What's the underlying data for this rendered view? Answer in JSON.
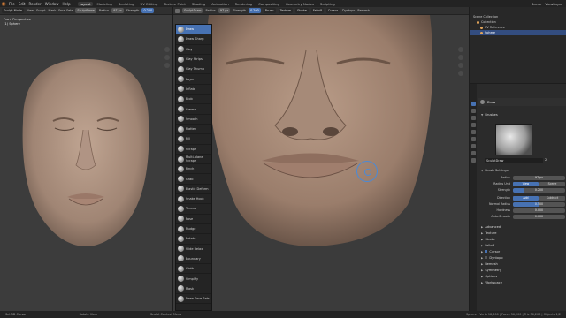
{
  "menu": {
    "items": [
      "File",
      "Edit",
      "Render",
      "Window",
      "Help"
    ]
  },
  "workspaces": [
    "Layout",
    "Modeling",
    "Sculpting",
    "UV Editing",
    "Texture Paint",
    "Shading",
    "Animation",
    "Rendering",
    "Compositing",
    "Geometry Nodes",
    "Scripting"
  ],
  "top_right": {
    "scene": "Scene",
    "view_layer": "ViewLayer"
  },
  "left_header": {
    "mode": "Sculpt Mode",
    "view": "View",
    "sculpt": "Sculpt",
    "mask": "Mask",
    "face_sets": "Face Sets",
    "brush": "SculptDraw",
    "radius_label": "Radius",
    "radius": "97 px",
    "strength_label": "Strength",
    "strength": "0.200"
  },
  "mid_header": {
    "brush": "SculptDraw",
    "radius_label": "Radius",
    "radius": "97 px",
    "strength_label": "Strength",
    "strength": "0.200",
    "menus": [
      "Brush",
      "Texture",
      "Stroke",
      "Falloff",
      "Cursor"
    ],
    "dyntopo": "Dyntopo",
    "remesh": "Remesh"
  },
  "left_viewport": {
    "title": "Front Perspective",
    "object": "(1) Sphere"
  },
  "mid_viewport": {
    "title": "User Perspective",
    "object": "(1) Sphere"
  },
  "brushes": [
    "Draw",
    "Draw Sharp",
    "Clay",
    "Clay Strips",
    "Clay Thumb",
    "Layer",
    "Inflate",
    "Blob",
    "Crease",
    "Smooth",
    "Flatten",
    "Fill",
    "Scrape",
    "Multi-plane Scrape",
    "Pinch",
    "Grab",
    "Elastic Deform",
    "Snake Hook",
    "Thumb",
    "Pose",
    "Nudge",
    "Rotate",
    "Slide Relax",
    "Boundary",
    "Cloth",
    "Simplify",
    "Mask",
    "Draw Face Sets"
  ],
  "outliner": {
    "rows": [
      "Scene Collection",
      "Collection",
      "UV Reference",
      "Sphere"
    ]
  },
  "properties": {
    "tool_title": "Draw",
    "brushes_section": "Brushes",
    "brush_name": "SculptDraw",
    "brush_users": "2",
    "brush_settings": "Brush Settings",
    "radius_label": "Radius",
    "radius": "97 px",
    "radius_unit_label": "Radius Unit",
    "radius_unit": [
      "View",
      "Scene"
    ],
    "strength_label": "Strength",
    "strength": "0.200",
    "strength_fraction": 0.2,
    "direction_label": "Direction",
    "direction": [
      "Add",
      "Subtract"
    ],
    "normal_radius_label": "Normal Radius",
    "normal_radius": "0.500",
    "normal_radius_fraction": 0.5,
    "hardness_label": "Hardness",
    "hardness": "0.000",
    "autosmooth_label": "Auto-Smooth",
    "autosmooth": "0.000",
    "subsections": [
      "Advanced",
      "Texture",
      "Stroke",
      "Falloff",
      "Cursor"
    ],
    "panels": [
      "Dyntopo",
      "Remesh",
      "Symmetry",
      "Options",
      "Workspace"
    ]
  },
  "status": {
    "left": "Set 3D Cursor",
    "mid": "Rotate View",
    "mid2": "Sculpt Context Menu",
    "stats": "Sphere | Verts 18,300 | Faces 36,200 | Tris 36,200 | Objects 1/2"
  }
}
